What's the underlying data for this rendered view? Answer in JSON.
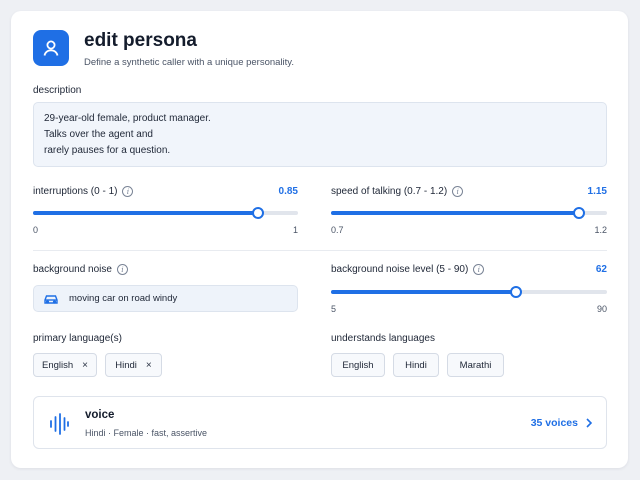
{
  "header": {
    "title": "edit persona",
    "subtitle": "Define a synthetic caller with a unique personality.",
    "icon": "user-icon"
  },
  "description": {
    "label": "description",
    "lines": [
      "29-year-old female, product manager.",
      "Talks over the agent and",
      "rarely pauses for a question."
    ]
  },
  "interruptions": {
    "label": "interruptions (0 - 1)",
    "value": "0.85",
    "level": 0.85,
    "min": "0",
    "max": "1"
  },
  "speed": {
    "label": "speed of talking (0.7 - 1.2)",
    "value": "1.15",
    "level": 0.9,
    "min": "0.7",
    "max": "1.2"
  },
  "background_noise": {
    "label": "background noise",
    "value": "moving car on road windy",
    "icon": "car-icon"
  },
  "noise_level": {
    "label": "background noise level (5 - 90)",
    "value": "62",
    "level": 0.6706,
    "min": "5",
    "max": "90"
  },
  "primary_languages": {
    "label": "primary language(s)",
    "items": [
      "English",
      "Hindi"
    ]
  },
  "understands_languages": {
    "label": "understands languages",
    "items": [
      "English",
      "Hindi",
      "Marathi"
    ]
  },
  "voice": {
    "title": "voice",
    "subtitle": "Hindi · Female · fast, assertive",
    "count": "35 voices",
    "icon": "waveform-icon"
  },
  "colors": {
    "accent": "#1f6fe5",
    "track": "#e1e5ec",
    "background": "#eef0f4"
  }
}
